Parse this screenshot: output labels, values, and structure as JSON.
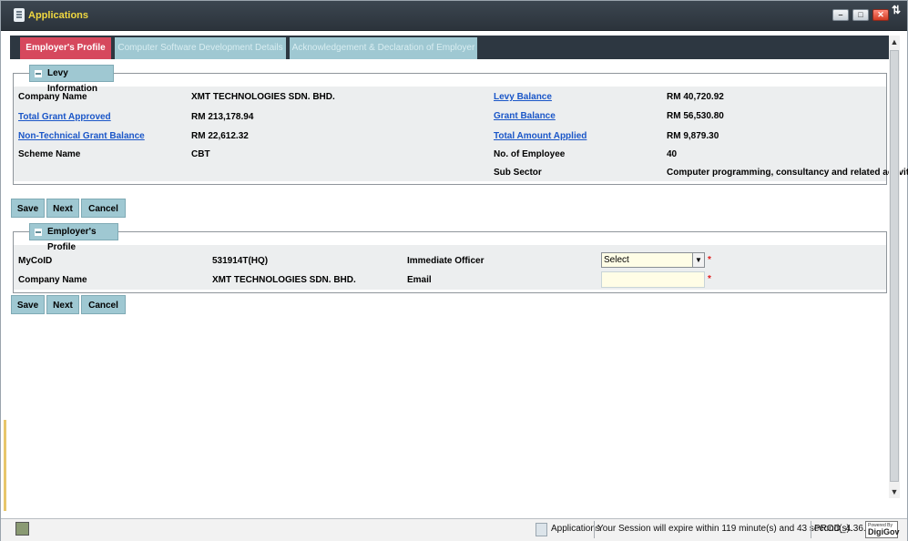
{
  "window": {
    "title": "Applications"
  },
  "tabs": [
    {
      "label": "Employer's Profile",
      "active": true
    },
    {
      "label": "Computer Software Development Details",
      "active": false
    },
    {
      "label": "Acknowledgement & Declaration of Employer",
      "active": false
    }
  ],
  "levy": {
    "legend": "Levy Information",
    "company_name_label": "Company Name",
    "company_name_value": "XMT TECHNOLOGIES SDN. BHD.",
    "levy_balance_label": "Levy Balance",
    "levy_balance_value": "RM 40,720.92",
    "total_grant_label": "Total Grant Approved",
    "total_grant_value": "RM 213,178.94",
    "grant_balance_label": "Grant Balance",
    "grant_balance_value": "RM 56,530.80",
    "non_tech_label": "Non-Technical Grant Balance",
    "non_tech_value": "RM 22,612.32",
    "total_amount_label": "Total Amount Applied",
    "total_amount_value": "RM 9,879.30",
    "scheme_label": "Scheme Name",
    "scheme_value": "CBT",
    "employees_label": "No. of Employee",
    "employees_value": "40",
    "sub_sector_label": "Sub Sector",
    "sub_sector_value": "Computer programming, consultancy and related activities"
  },
  "actions": {
    "save": "Save",
    "next": "Next",
    "cancel": "Cancel"
  },
  "profile": {
    "legend": "Employer's Profile",
    "mycoid_label": "MyCoID",
    "mycoid_value": "531914T(HQ)",
    "company_name_label": "Company Name",
    "company_name_value": "XMT TECHNOLOGIES SDN. BHD.",
    "officer_label": "Immediate Officer",
    "officer_selected": "Select",
    "email_label": "Email",
    "email_value": "",
    "required_mark": "*"
  },
  "status": {
    "app_label": "Applications",
    "session_text": "Your Session will expire within 119 minute(s) and 43 second(s).",
    "version": "PROD_4.36.0",
    "logo_small": "Powered By",
    "logo_big": "DigiGov"
  },
  "colors": {
    "active_tab": "#d6485d",
    "inactive_tab": "#9fc8d2",
    "title_text": "#f0d840",
    "link": "#1a56c8"
  }
}
